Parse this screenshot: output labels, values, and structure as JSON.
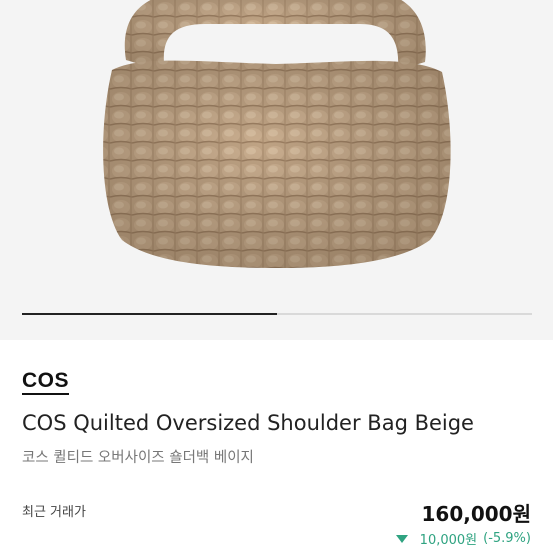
{
  "product": {
    "brand": "COS",
    "title_en": "COS Quilted Oversized Shoulder Bag Beige",
    "title_ko": "코스 퀼티드 오버사이즈 숄더백 베이지",
    "image_icon": "quilted-bag-photo"
  },
  "price": {
    "label": "최근 거래가",
    "value": "160,000원",
    "change_amount": "10,000원",
    "change_percent": "(-5.9%)",
    "change_direction": "down",
    "change_color": "#2fa381"
  },
  "gallery": {
    "current_slide": 1,
    "total_slides": 2
  }
}
